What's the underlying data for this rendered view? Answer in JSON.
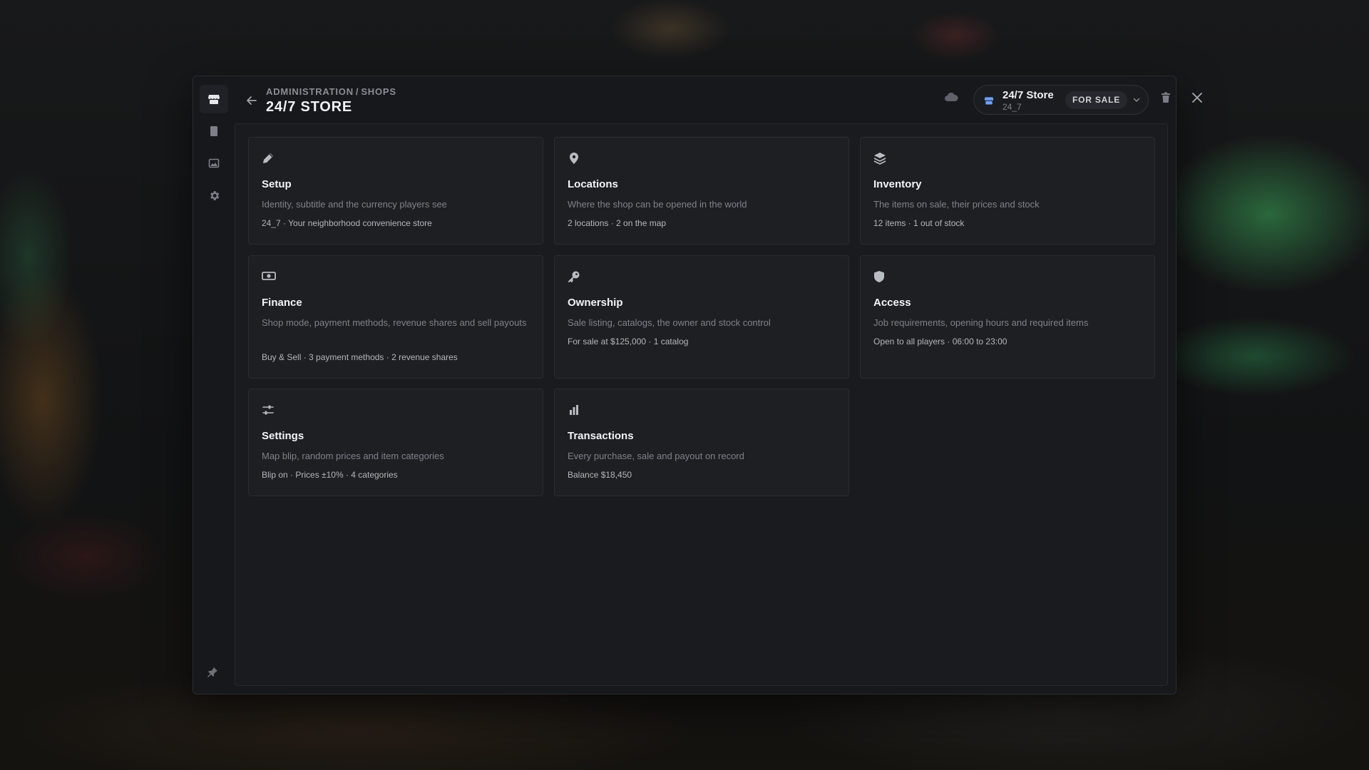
{
  "header": {
    "breadcrumb": [
      "ADMINISTRATION",
      "SHOPS"
    ],
    "breadcrumb_separator": "/",
    "title": "24/7 STORE"
  },
  "rail": {
    "items": [
      {
        "name": "store",
        "icon": "store-icon",
        "active": true
      },
      {
        "name": "book",
        "icon": "book-icon",
        "active": false
      },
      {
        "name": "gallery",
        "icon": "image-icon",
        "active": false
      },
      {
        "name": "settings",
        "icon": "gear-icon",
        "active": false
      }
    ],
    "pin_icon": "pin-icon"
  },
  "shop_picker": {
    "name": "24/7 Store",
    "id": "24_7",
    "status": "FOR SALE"
  },
  "cards": [
    {
      "icon": "pencil-icon",
      "title": "Setup",
      "description": "Identity, subtitle and the currency players see",
      "meta": "24_7 · Your neighborhood convenience store"
    },
    {
      "icon": "location-pin-icon",
      "title": "Locations",
      "description": "Where the shop can be opened in the world",
      "meta": "2 locations · 2 on the map"
    },
    {
      "icon": "layers-icon",
      "title": "Inventory",
      "description": "The items on sale, their prices and stock",
      "meta": "12 items · 1 out of stock"
    },
    {
      "icon": "money-icon",
      "title": "Finance",
      "description": "Shop mode, payment methods, revenue shares and sell payouts",
      "meta": "Buy & Sell · 3 payment methods · 2 revenue shares"
    },
    {
      "icon": "key-icon",
      "title": "Ownership",
      "description": "Sale listing, catalogs, the owner and stock control",
      "meta": "For sale at $125,000 · 1 catalog"
    },
    {
      "icon": "shield-icon",
      "title": "Access",
      "description": "Job requirements, opening hours and required items",
      "meta": "Open to all players · 06:00 to 23:00"
    },
    {
      "icon": "sliders-icon",
      "title": "Settings",
      "description": "Map blip, random prices and item categories",
      "meta": "Blip on · Prices ±10% · 4 categories"
    },
    {
      "icon": "bar-chart-icon",
      "title": "Transactions",
      "description": "Every purchase, sale and payout on record",
      "meta": "Balance $18,450"
    }
  ],
  "colors": {
    "accent": "#6ea0ff",
    "panel": "#17181b",
    "card": "#1e1f23"
  }
}
